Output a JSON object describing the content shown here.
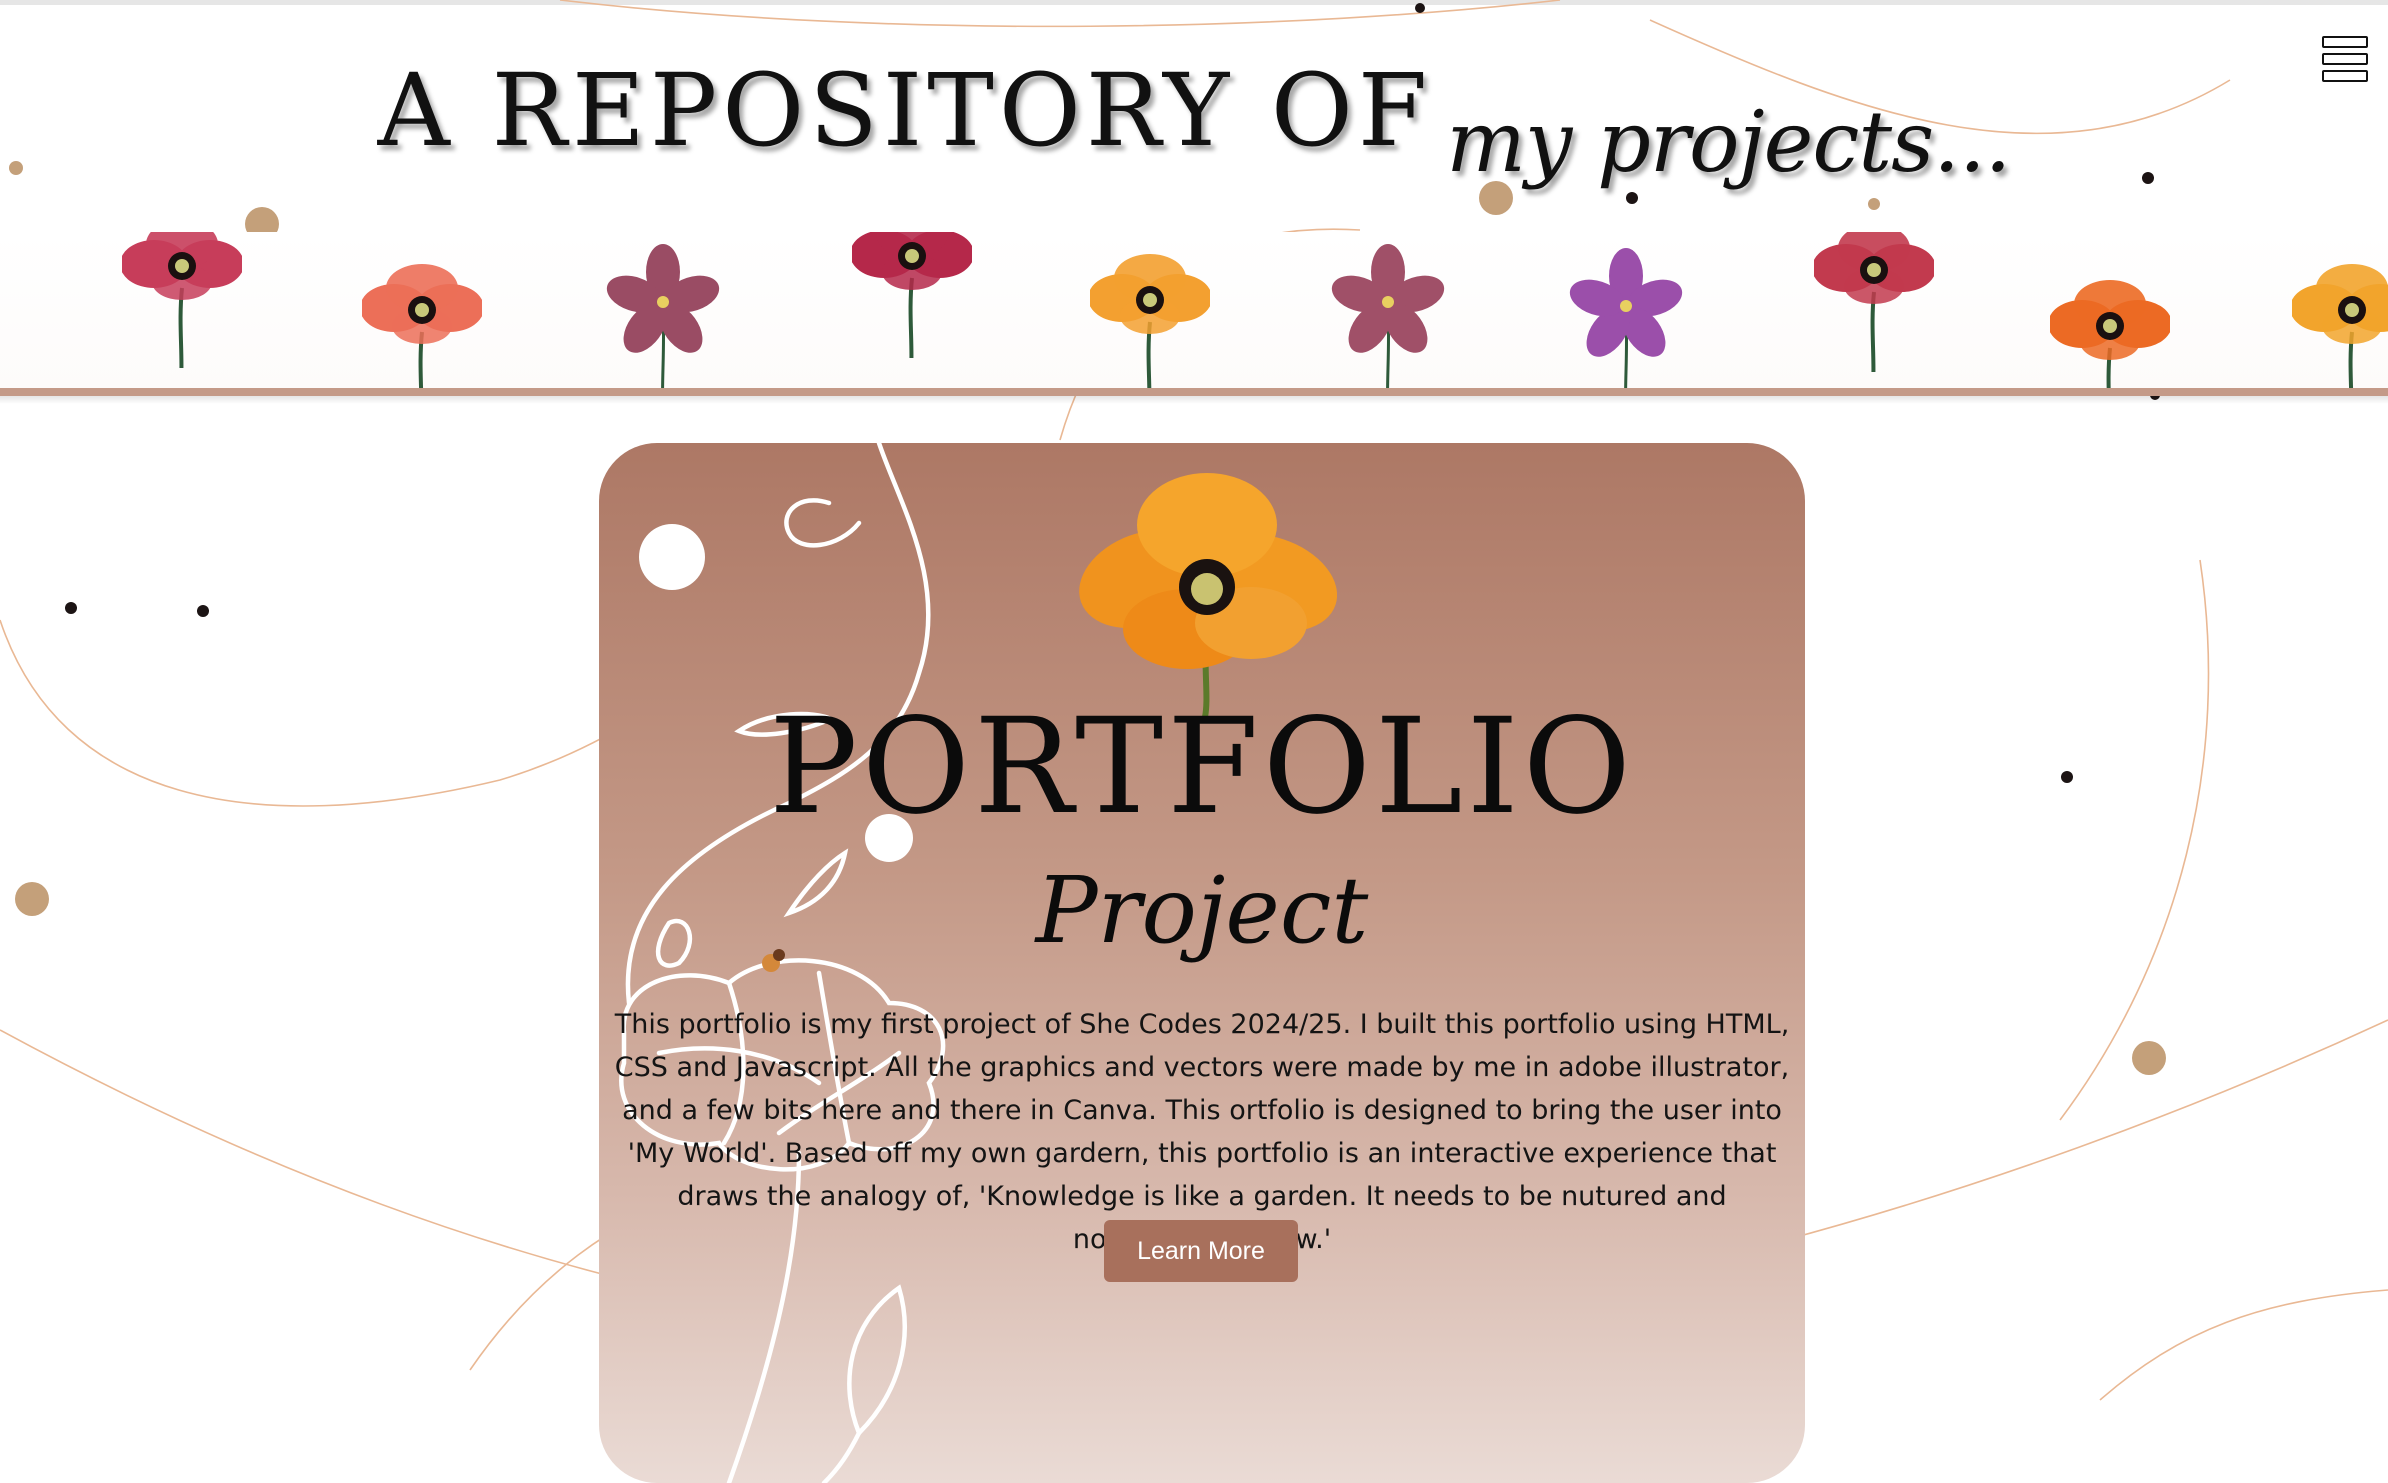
{
  "header": {
    "title_main": "A REPOSITORY OF",
    "title_script": "my projects...",
    "menu_icon": "hamburger-menu-icon"
  },
  "banner": {
    "flowers": [
      "red-poppy-icon",
      "coral-flower-icon",
      "mauve-flower-icon",
      "crimson-poppy-icon",
      "orange-poppy-icon",
      "mauve-flower-icon",
      "purple-flower-icon",
      "red-poppy-icon",
      "orange-poppy-icon",
      "orange-poppy-icon"
    ]
  },
  "card": {
    "heading": "PORTFOLIO",
    "subheading": "Project",
    "description": "This portfolio is my first project of She Codes 2024/25. I built this portfolio using HTML, CSS and Javascript. All the graphics and vectors were made by me in adobe illustrator, and a few bits here and there in Canva. This ortfolio is designed to bring the user into 'My World'. Based off my own gardern, this portfolio is an interactive experience that draws the analogy of, 'Knowledge is like a garden. It needs to be nutured and nourished to grow.'",
    "button_label": "Learn More",
    "flower_icon": "orange-poppy-icon"
  },
  "colors": {
    "accent": "#a8705c",
    "card_top": "#ad7865",
    "card_bottom": "#eadbd5",
    "banner_border": "#c49a88",
    "dot_gold": "#c4a07a",
    "curve": "#e9b894"
  }
}
